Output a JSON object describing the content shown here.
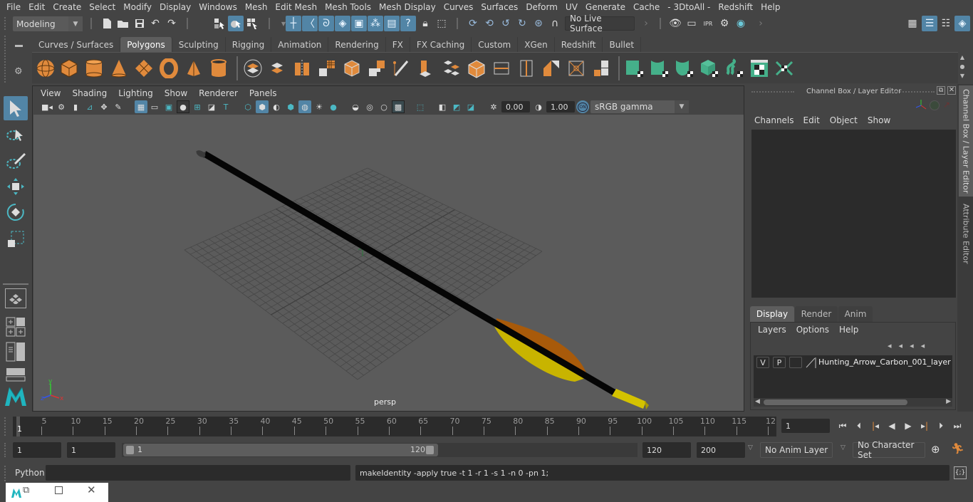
{
  "menubar": {
    "items": [
      "File",
      "Edit",
      "Create",
      "Select",
      "Modify",
      "Display",
      "Windows",
      "Mesh",
      "Edit Mesh",
      "Mesh Tools",
      "Mesh Display",
      "Curves",
      "Surfaces",
      "Deform",
      "UV",
      "Generate",
      "Cache",
      "- 3DtoAll -",
      "Redshift",
      "Help"
    ]
  },
  "statusline": {
    "mode": "Modeling",
    "live_surface": "No Live Surface"
  },
  "shelf": {
    "tabs": [
      "Curves / Surfaces",
      "Polygons",
      "Sculpting",
      "Rigging",
      "Animation",
      "Rendering",
      "FX",
      "FX Caching",
      "Custom",
      "XGen",
      "Redshift",
      "Bullet"
    ],
    "active_tab": "Polygons",
    "poly_icons": [
      "sphere-icon",
      "cube-icon",
      "cylinder-icon",
      "cone-icon",
      "plane-icon",
      "torus-icon",
      "pyramid-icon",
      "pipe-icon"
    ],
    "edit_icons": [
      "combine-icon",
      "separate-icon",
      "mirror-icon",
      "smooth-icon",
      "bevel-cube-icon",
      "subdivide-icon",
      "multi-cut-icon",
      "extrude-icon",
      "bridge-icon",
      "bevel-icon",
      "edge-loop-icon",
      "insert-loop-icon",
      "offset-loop-icon",
      "merge-icon",
      "split-icon"
    ],
    "uv_icons": [
      "planar-uv-icon",
      "cylindrical-uv-icon",
      "spherical-uv-icon",
      "auto-uv-icon",
      "unfold-uv-icon",
      "uv-editor-icon",
      "layout-uv-icon"
    ]
  },
  "viewport_panel": {
    "menu": [
      "View",
      "Shading",
      "Lighting",
      "Show",
      "Renderer",
      "Panels"
    ],
    "exposure": "0.00",
    "gamma": "1.00",
    "color_mgmt_toggle": "ON",
    "color_space": "sRGB gamma",
    "camera_label": "persp",
    "axis_labels": {
      "x": "x",
      "y": "y",
      "z": "z"
    },
    "colors": {
      "viewport_bg": "#5b5b5b",
      "grid": "#474747",
      "shaft": "#050505",
      "vane_orange": "#a85a0a",
      "vane_yellow": "#c8b400",
      "nock": "#d4c200"
    }
  },
  "channel_box": {
    "title": "Channel Box / Layer Editor",
    "menu": [
      "Channels",
      "Edit",
      "Object",
      "Show"
    ]
  },
  "layer_editor": {
    "tabs": [
      "Display",
      "Render",
      "Anim"
    ],
    "active_tab": "Display",
    "menu": [
      "Layers",
      "Options",
      "Help"
    ],
    "layers": [
      {
        "visible": "V",
        "playback": "P",
        "name": "Hunting_Arrow_Carbon_001_layer"
      }
    ]
  },
  "side_tabs": [
    "Channel Box / Layer Editor",
    "Attribute Editor"
  ],
  "timeline": {
    "start_marker": "1",
    "ticks": [
      "5",
      "10",
      "15",
      "20",
      "25",
      "30",
      "35",
      "40",
      "45",
      "50",
      "55",
      "60",
      "65",
      "70",
      "75",
      "80",
      "85",
      "90",
      "95",
      "100",
      "105",
      "110",
      "115",
      "12"
    ],
    "current_frame": "1"
  },
  "range": {
    "start": "1",
    "playback_start": "1",
    "slider_min": "1",
    "slider_max": "120",
    "playback_end": "120",
    "end": "200",
    "anim_layer": "No Anim Layer",
    "character_set": "No Character Set"
  },
  "command_line": {
    "language": "Python",
    "input": "",
    "result": "makeIdentity -apply true -t 1 -r 1 -s 1 -n 0 -pn 1;"
  },
  "accent_color": "#5285a6"
}
